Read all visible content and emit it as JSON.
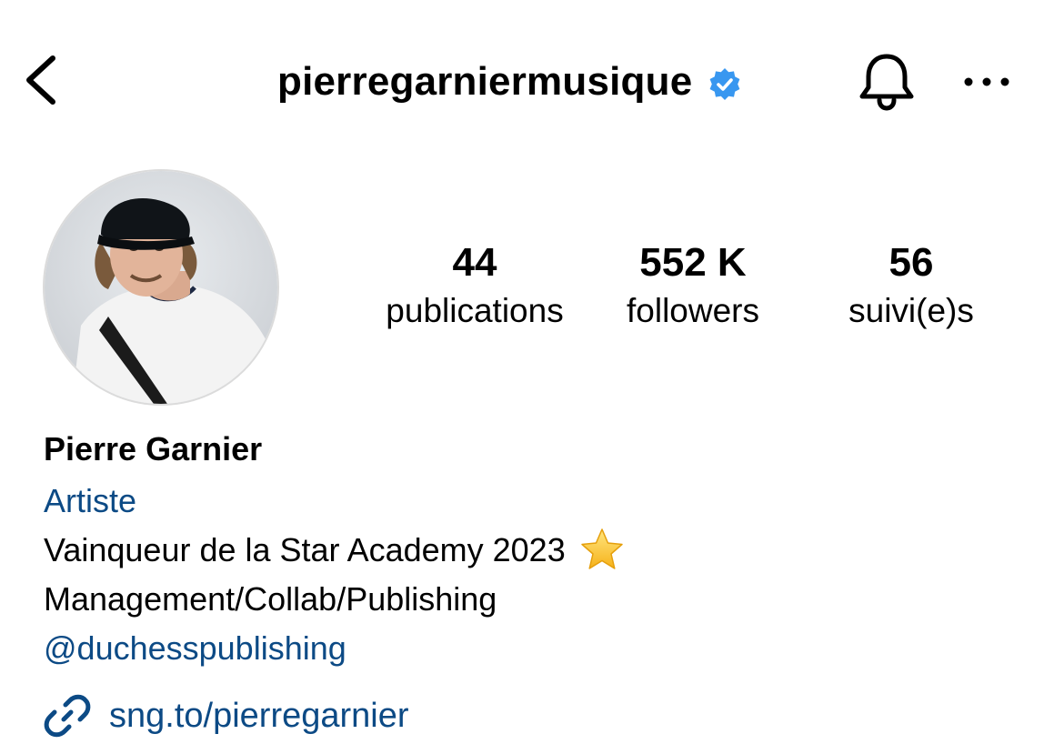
{
  "header": {
    "username": "pierregarniermusique",
    "verified": true,
    "icons": {
      "back": "chevron-left-icon",
      "bell": "bell-icon",
      "more": "more-horizontal-icon",
      "verified": "verified-badge-icon"
    }
  },
  "stats": [
    {
      "value": "44",
      "label": "publications"
    },
    {
      "value": "552 K",
      "label": "followers"
    },
    {
      "value": "56",
      "label": "suivi(e)s"
    }
  ],
  "bio": {
    "name": "Pierre Garnier",
    "category": "Artiste",
    "line1": "Vainqueur de la Star Academy 2023",
    "line1_emoji": "star-emoji",
    "line2": "Management/Collab/Publishing",
    "mention": "@duchesspublishing",
    "link": "sng.to/pierregarnier"
  },
  "colors": {
    "link": "#0c4a85",
    "verified": "#3897f0",
    "text": "#000000",
    "background": "#ffffff"
  }
}
